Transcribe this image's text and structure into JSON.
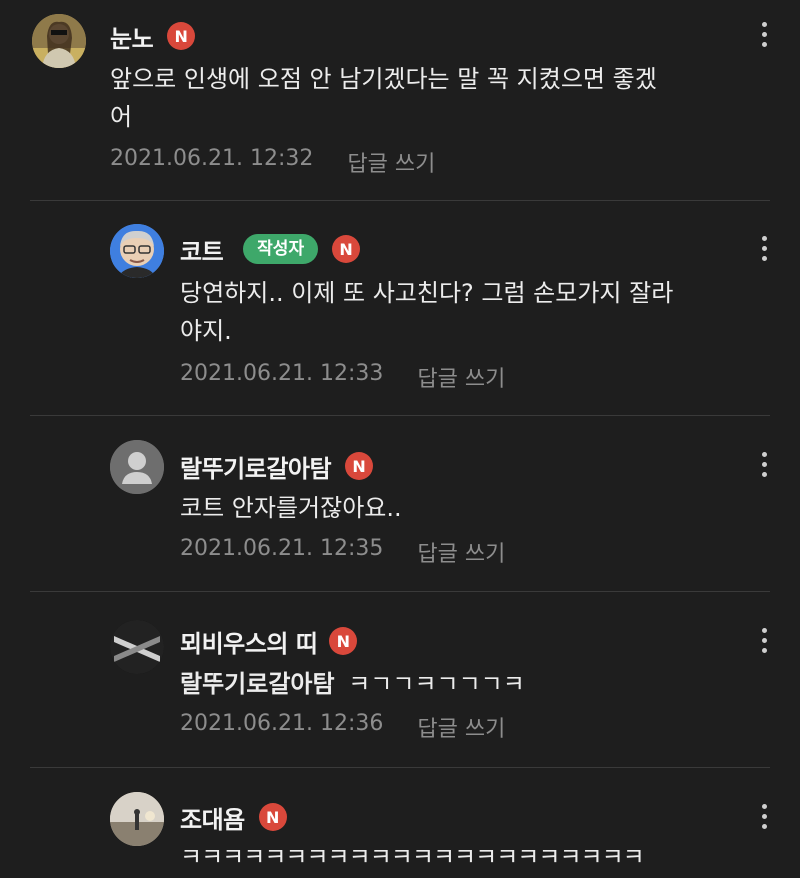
{
  "comments": [
    {
      "author": "눈노",
      "badge": "N",
      "text_line1": "앞으로 인생에 오점 안 남기겠다는 말 꼭 지켰으면 좋겠",
      "text_line2": "어",
      "time": "2021.06.21. 12:32",
      "reply": "답글 쓰기"
    },
    {
      "author": "코트",
      "writer_badge": "작성자",
      "badge": "N",
      "text_line1": "당연하지.. 이제 또 사고친다? 그럼 손모가지 잘라",
      "text_line2": "야지.",
      "time": "2021.06.21. 12:33",
      "reply": "답글 쓰기"
    },
    {
      "author": "랄뚜기로갈아탐",
      "badge": "N",
      "text": "코트 안자를거잖아요..",
      "time": "2021.06.21. 12:35",
      "reply": "답글 쓰기"
    },
    {
      "author": "뫼비우스의 띠",
      "badge": "N",
      "mention": "랄뚜기로갈아탐",
      "text": "ㅋㄱㄱㅋㄱㄱㄱㅋ",
      "time": "2021.06.21. 12:36",
      "reply": "답글 쓰기"
    },
    {
      "author": "조대욤",
      "badge": "N",
      "text": "ㅋㅋㅋㅋㅋㅋㅋㅋㅋㅋㅋㅋㅋㅋㅋㅋㅋㅋㅋㅋㅋㅋ"
    }
  ],
  "colors": {
    "background": "#1e1e1e",
    "badge_n": "#d9483b",
    "writer_badge": "#3ea86a",
    "meta_text": "#8d8d8d"
  },
  "icons": {
    "more": "vertical-ellipsis-icon",
    "default_avatar": "person-silhouette-icon"
  }
}
